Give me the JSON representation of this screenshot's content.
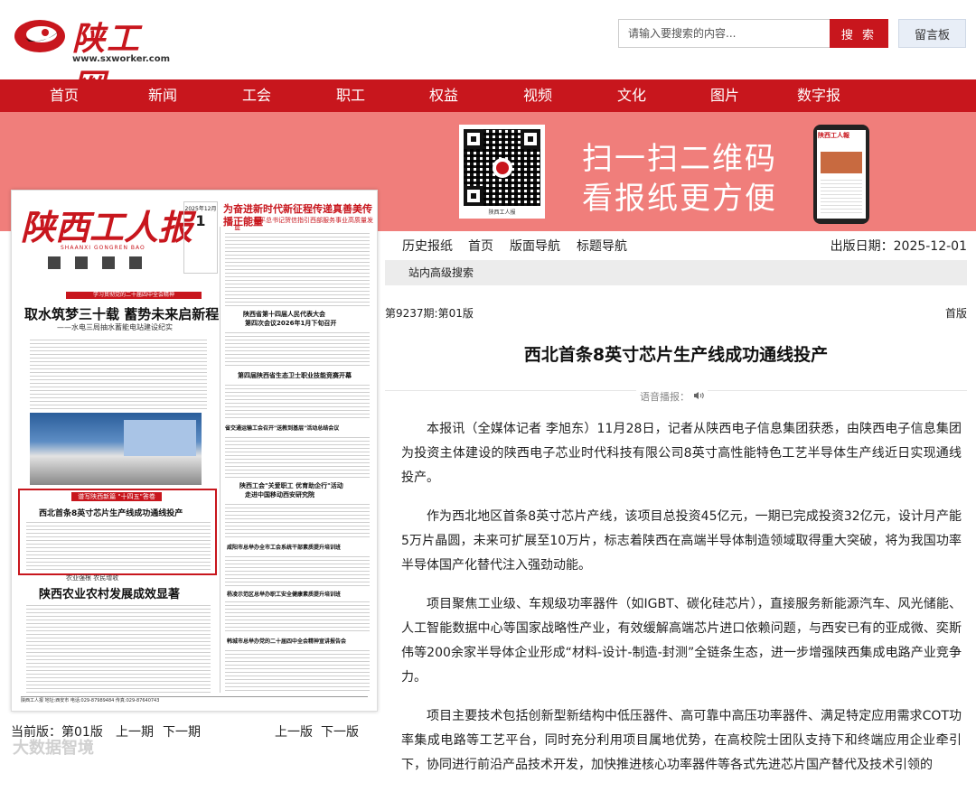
{
  "site": {
    "logo_text": "陕工网",
    "logo_url": "www.sxworker.com"
  },
  "search": {
    "placeholder": "请输入要搜索的内容...",
    "button_label": "搜 索",
    "guestbook_label": "留言板"
  },
  "nav": {
    "items": [
      "首页",
      "新闻",
      "工会",
      "职工",
      "权益",
      "视频",
      "文化",
      "图片",
      "数字报"
    ]
  },
  "banner": {
    "line1": "扫一扫二维码",
    "line2": "看报纸更方便",
    "qr_caption": "陕西工人报",
    "phone_title": "陕西工人報"
  },
  "newspaper": {
    "masthead": "陕西工人报",
    "masthead_pinyin": "SHAANXI GONGREN BAO",
    "date_day": "1",
    "date_top": "2025年12月",
    "right_headline": "为奋进新时代新征程传递真善美传播正能量",
    "right_sub": "——习近平总书记贺信指引西部服务事业高质量发展",
    "band": "学习贯彻党的二十届四中全会精神",
    "main_headline": "取水筑梦三十载  蓄势未来启新程",
    "main_sub": "——水电三局抽水蓄能电站建设纪实",
    "box_label": "谱写陕西新篇 \"十四五\"答卷",
    "box_title": "西北首条8英寸芯片生产线成功通线投产",
    "lower_kicker": "农业强根 农民增收",
    "lower_headline": "陕西农业农村发展成效显著",
    "r1": "陕西省第十四届人民代表大会",
    "r1b": "第四次会议2026年1月下旬召开",
    "r2": "第四届陕西省生态卫士职业技能竞赛开幕",
    "r3": "省交通运输工会召开\"送教到基层\"活动总结会议",
    "r4": "陕西工会\"关爱职工  优育助企行\"活动",
    "r4b": "走进中国移动西安研究院",
    "r5": "咸阳市总举办全市工会系统干部素质提升培训班",
    "r6": "杨凌示范区总举办职工安全健康素质提升培训班",
    "r7": "韩城市总举办党的二十届四中全会精神宣讲报告会",
    "footer": "陕西工人报  地址:西安市  电话:029-87989484  传真:029-87640743"
  },
  "page_nav": {
    "current": "当前版：第01版",
    "prev_issue": "上一期",
    "next_issue": "下一期",
    "prev_page": "上一版",
    "next_page": "下一版"
  },
  "sub_nav": {
    "items": [
      "历史报纸",
      "首页",
      "版面导航",
      "标题导航"
    ],
    "pub_date": "出版日期：2025-12-01",
    "site_search": "站内高级搜索"
  },
  "article": {
    "issue": "第9237期:第01版",
    "section": "首版",
    "title": "西北首条8英寸芯片生产线成功通线投产",
    "tts_label": "语音播报：",
    "paragraphs": [
      "本报讯（全媒体记者  李旭东）11月28日，记者从陕西电子信息集团获悉，由陕西电子信息集团为投资主体建设的陕西电子芯业时代科技有限公司8英寸高性能特色工艺半导体生产线近日实现通线投产。",
      "作为西北地区首条8英寸芯片产线，该项目总投资45亿元，一期已完成投资32亿元，设计月产能5万片晶圆，未来可扩展至10万片，标志着陕西在高端半导体制造领域取得重大突破，将为我国功率半导体国产化替代注入强劲动能。",
      "项目聚焦工业级、车规级功率器件（如IGBT、碳化硅芯片），直接服务新能源汽车、风光储能、人工智能数据中心等国家战略性产业，有效缓解高端芯片进口依赖问题，与西安已有的亚成微、奕斯伟等200余家半导体企业形成“材料-设计-制造-封测”全链条生态，进一步增强陕西集成电路产业竞争力。",
      "项目主要技术包括创新型新结构中低压器件、高可靠中高压功率器件、满足特定应用需求COT功率集成电路等工艺平台，同时充分利用项目属地优势，在高校院士团队支持下和终端应用企业牵引下，协同进行前沿产品技术开发，加快推进核心功率器件等各式先进芯片国产替代及技术引领的"
    ]
  },
  "watermark": "大数据智境",
  "colors": {
    "brand_red": "#c8161d",
    "banner_pink": "#f07e7b"
  }
}
